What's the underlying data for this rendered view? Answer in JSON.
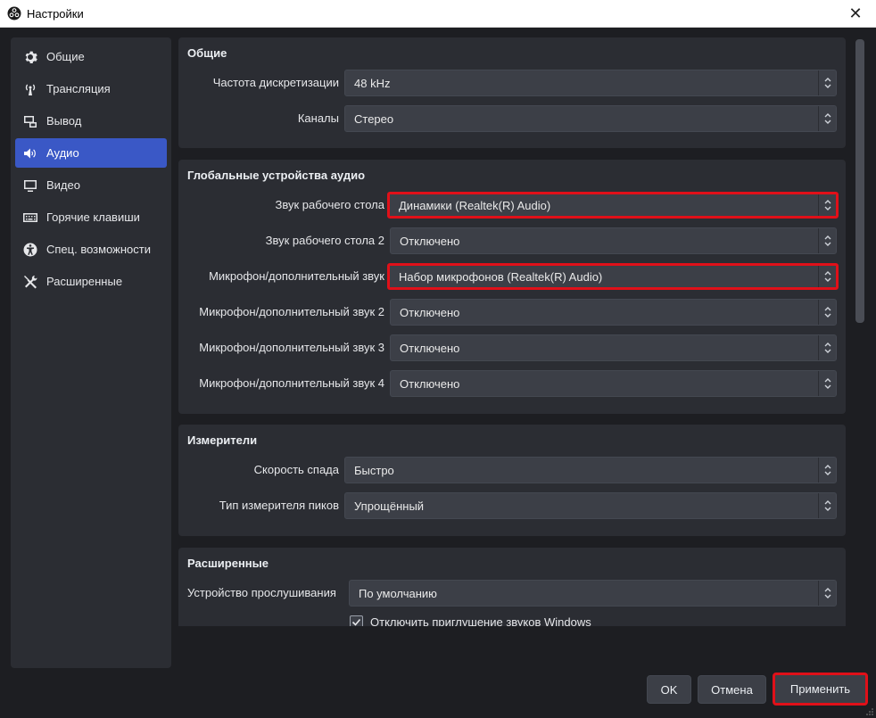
{
  "window": {
    "title": "Настройки",
    "close_glyph": "✕"
  },
  "sidebar": {
    "items": [
      {
        "label": "Общие",
        "icon": "gear-icon"
      },
      {
        "label": "Трансляция",
        "icon": "antenna-icon"
      },
      {
        "label": "Вывод",
        "icon": "output-icon"
      },
      {
        "label": "Аудио",
        "icon": "speaker-icon",
        "active": true
      },
      {
        "label": "Видео",
        "icon": "monitor-icon"
      },
      {
        "label": "Горячие клавиши",
        "icon": "keyboard-icon"
      },
      {
        "label": "Спец. возможности",
        "icon": "accessibility-icon"
      },
      {
        "label": "Расширенные",
        "icon": "tools-icon"
      }
    ]
  },
  "general": {
    "title": "Общие",
    "sample_rate_label": "Частота дискретизации",
    "sample_rate_value": "48 kHz",
    "channels_label": "Каналы",
    "channels_value": "Стерео"
  },
  "devices": {
    "title": "Глобальные устройства аудио",
    "desktop_label": "Звук рабочего стола",
    "desktop_value": "Динамики (Realtek(R) Audio)",
    "desktop2_label": "Звук рабочего стола 2",
    "desktop2_value": "Отключено",
    "mic_label": "Микрофон/дополнительный звук",
    "mic_value": "Набор микрофонов (Realtek(R) Audio)",
    "mic2_label": "Микрофон/дополнительный звук 2",
    "mic2_value": "Отключено",
    "mic3_label": "Микрофон/дополнительный звук 3",
    "mic3_value": "Отключено",
    "mic4_label": "Микрофон/дополнительный звук 4",
    "mic4_value": "Отключено"
  },
  "meters": {
    "title": "Измерители",
    "decay_label": "Скорость спада",
    "decay_value": "Быстро",
    "peak_label": "Тип измерителя пиков",
    "peak_value": "Упрощённый"
  },
  "advanced": {
    "title": "Расширенные",
    "monitor_label": "Устройство прослушивания",
    "monitor_value": "По умолчанию",
    "ducking_label": "Отключить приглушение звуков Windows",
    "ducking_checked": true
  },
  "buttons": {
    "ok": "OK",
    "cancel": "Отмена",
    "apply": "Применить"
  },
  "colors": {
    "accent": "#3a58c6",
    "highlight": "#e01019",
    "panel": "#2b2d33",
    "background": "#1d1e22"
  }
}
